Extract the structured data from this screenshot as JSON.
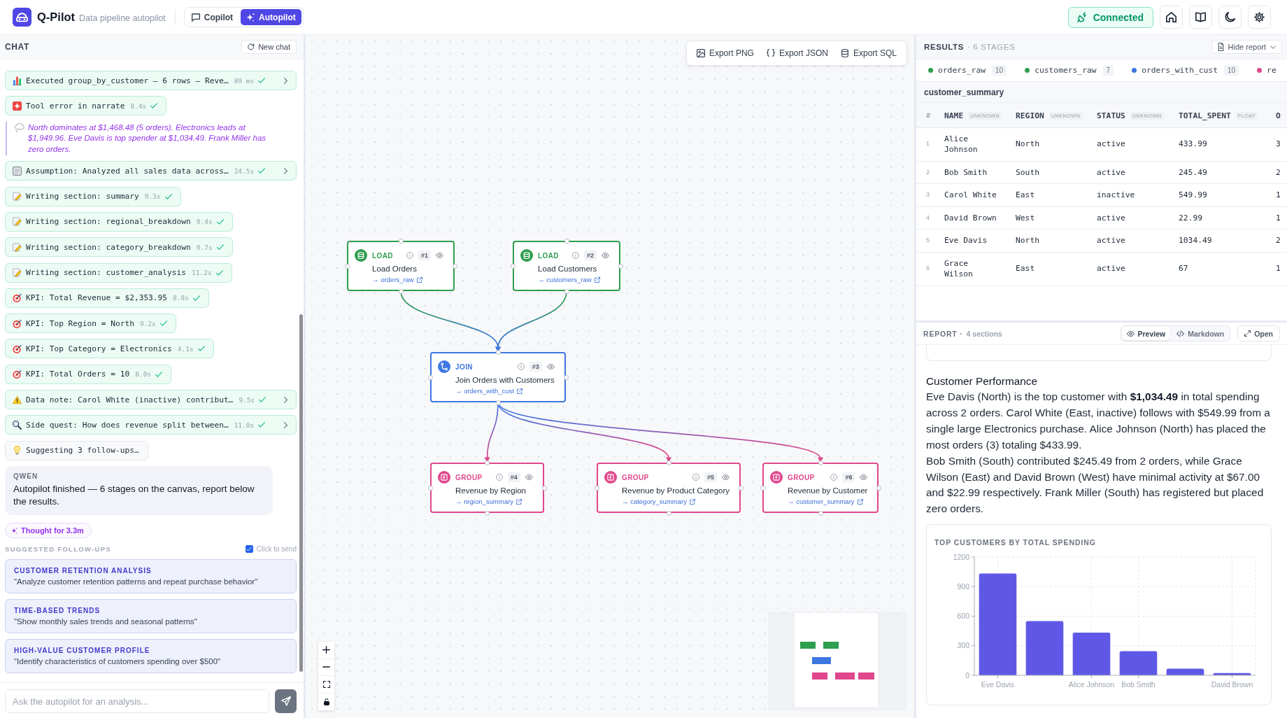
{
  "app": {
    "name": "Q-Pilot",
    "subtitle": "Data pipeline autopilot",
    "modes": [
      {
        "kind": "copilot",
        "label": "Copilot",
        "selected": false
      },
      {
        "kind": "autopilot",
        "label": "Autopilot",
        "selected": true
      }
    ],
    "connection": {
      "label": "Connected",
      "on": true
    }
  },
  "chat": {
    "title": "CHAT",
    "new_chat": "New chat",
    "messages": [
      {
        "kind": "executed",
        "text": "Executed group_by_customer — 6 rows — Reve…",
        "time": "89 ms",
        "done": true,
        "expandable": true
      },
      {
        "kind": "error",
        "text": "Tool error in narrate",
        "time": "8.4s",
        "done": true,
        "expandable": false
      },
      {
        "kind": "narration",
        "text": "North dominates at $1,468.48 (5 orders). Electronics leads at $1,949.96. Eve Davis is top spender at $1,034.49. Frank Miller has zero orders."
      },
      {
        "kind": "assumption",
        "text": "Assumption: Analyzed all sales data across…",
        "time": "24.5s",
        "done": true,
        "expandable": true
      },
      {
        "kind": "writing",
        "text": "Writing section: summary",
        "time": "9.3s",
        "done": true,
        "expandable": false
      },
      {
        "kind": "writing",
        "text": "Writing section: regional_breakdown",
        "time": "9.4s",
        "done": true,
        "expandable": false
      },
      {
        "kind": "writing",
        "text": "Writing section: category_breakdown",
        "time": "9.7s",
        "done": true,
        "expandable": false
      },
      {
        "kind": "writing",
        "text": "Writing section: customer_analysis",
        "time": "11.2s",
        "done": true,
        "expandable": false
      },
      {
        "kind": "kpi",
        "text": "KPI: Total Revenue = $2,353.95",
        "time": "8.8s",
        "done": true,
        "expandable": false
      },
      {
        "kind": "kpi",
        "text": "KPI: Top Region = North",
        "time": "9.2s",
        "done": true,
        "expandable": false
      },
      {
        "kind": "kpi",
        "text": "KPI: Top Category = Electronics",
        "time": "4.1s",
        "done": true,
        "expandable": false
      },
      {
        "kind": "kpi",
        "text": "KPI: Total Orders = 10",
        "time": "8.0s",
        "done": true,
        "expandable": false
      },
      {
        "kind": "note",
        "text": "Data note: Carol White (inactive) contribut…",
        "time": "9.5s",
        "done": true,
        "expandable": true
      },
      {
        "kind": "side_quest",
        "text": "Side quest: How does revenue split between…",
        "time": "11.0s",
        "done": true,
        "expandable": true
      },
      {
        "kind": "suggesting",
        "text": "Suggesting 3 follow-ups…",
        "done": false,
        "expandable": false
      },
      {
        "kind": "assistant",
        "author": "QWEN",
        "text": "Autopilot finished — 6 stages on the canvas, report below the results."
      },
      {
        "kind": "thought",
        "text": "Thought for 3.3m"
      }
    ],
    "followups": {
      "title": "SUGGESTED FOLLOW-UPS",
      "click_to_send": {
        "label": "Click to send",
        "checked": true
      },
      "items": [
        {
          "title": "CUSTOMER RETENTION ANALYSIS",
          "prompt": "\"Analyze customer retention patterns and repeat purchase behavior\""
        },
        {
          "title": "TIME-BASED TRENDS",
          "prompt": "\"Show monthly sales trends and seasonal patterns\""
        },
        {
          "title": "HIGH-VALUE CUSTOMER PROFILE",
          "prompt": "\"Identify characteristics of customers spending over $500\""
        }
      ]
    },
    "composer": {
      "placeholder": "Ask the autopilot for an analysis..."
    }
  },
  "canvas": {
    "exports": [
      {
        "kind": "png",
        "label": "Export PNG"
      },
      {
        "kind": "json",
        "label": "Export JSON"
      },
      {
        "kind": "sql",
        "label": "Export SQL"
      }
    ],
    "layers": [
      {
        "nodes": [
          {
            "kind": "load",
            "type": "LOAD",
            "index": "#1",
            "title": "Load Orders",
            "output": "→ orders_raw"
          },
          {
            "kind": "load",
            "type": "LOAD",
            "index": "#2",
            "title": "Load Customers",
            "output": "→ customers_raw"
          }
        ]
      },
      {
        "nodes": [
          {
            "kind": "join",
            "type": "JOIN",
            "index": "#3",
            "title": "Join Orders with Customers",
            "output": "→ orders_with_cust"
          }
        ]
      },
      {
        "nodes": [
          {
            "kind": "group",
            "type": "GROUP",
            "index": "#4",
            "title": "Revenue by Region",
            "output": "→ region_summary"
          },
          {
            "kind": "group",
            "type": "GROUP",
            "index": "#5",
            "title": "Revenue by Product Category",
            "output": "→ category_summary"
          },
          {
            "kind": "group",
            "type": "GROUP",
            "index": "#6",
            "title": "Revenue by Customer",
            "output": "→ customer_summary"
          }
        ]
      }
    ]
  },
  "results": {
    "title": "RESULTS",
    "subtitle": "· 6 STAGES",
    "hide_report": "Hide report",
    "stages": [
      {
        "name": "orders_raw",
        "count": "10",
        "color": "#2e9e4f"
      },
      {
        "name": "customers_raw",
        "count": "7",
        "color": "#2e9e4f"
      },
      {
        "name": "orders_with_cust",
        "count": "10",
        "color": "#3d77e2"
      },
      {
        "name": "re",
        "color": "#e0478c"
      }
    ],
    "table": {
      "title": "customer_summary",
      "columns": [
        {
          "name": "#"
        },
        {
          "name": "NAME",
          "type": "UNKNOWN"
        },
        {
          "name": "REGION",
          "type": "UNKNOWN"
        },
        {
          "name": "STATUS",
          "type": "UNKNOWN"
        },
        {
          "name": "TOTAL_SPENT",
          "type": "FLOAT"
        },
        {
          "name": "O"
        }
      ],
      "rows": [
        [
          "1",
          "Alice Johnson",
          "North",
          "active",
          "433.99",
          "3"
        ],
        [
          "2",
          "Bob Smith",
          "South",
          "active",
          "245.49",
          "2"
        ],
        [
          "3",
          "Carol White",
          "East",
          "inactive",
          "549.99",
          "1"
        ],
        [
          "4",
          "David Brown",
          "West",
          "active",
          "22.99",
          "1"
        ],
        [
          "5",
          "Eve Davis",
          "North",
          "active",
          "1034.49",
          "2"
        ],
        [
          "6",
          "Grace Wilson",
          "East",
          "active",
          "67",
          "1"
        ]
      ]
    }
  },
  "report": {
    "title": "REPORT ·",
    "count": "4 sections",
    "views": [
      {
        "kind": "preview",
        "label": "Preview",
        "selected": true
      },
      {
        "kind": "markdown",
        "label": "Markdown",
        "selected": false
      }
    ],
    "open": "Open",
    "heading": "Customer Performance",
    "paragraphs": [
      "Eve Davis (North) is the top customer with **$1,034.49** in total spending across 2 orders. Carol White (East, inactive) follows with $549.99 from a single large Electronics purchase. Alice Johnson (North) has placed the most orders (3) totaling $433.99.",
      "Bob Smith (South) contributed $245.49 from 2 orders, while Grace Wilson (East) and David Brown (West) have minimal activity at $67.00 and $22.99 respectively. Frank Miller (South) has registered but placed zero orders."
    ],
    "chart_data": {
      "type": "bar",
      "title": "TOP CUSTOMERS BY TOTAL SPENDING",
      "categories": [
        "Eve Davis",
        null,
        "Alice Johnson",
        "Bob Smith",
        null,
        "David Brown"
      ],
      "values": [
        1034,
        550,
        434,
        245,
        67,
        23
      ],
      "ylim": [
        0,
        1200
      ],
      "yticks": [
        0,
        300,
        600,
        900,
        1200
      ],
      "grid": true
    }
  }
}
